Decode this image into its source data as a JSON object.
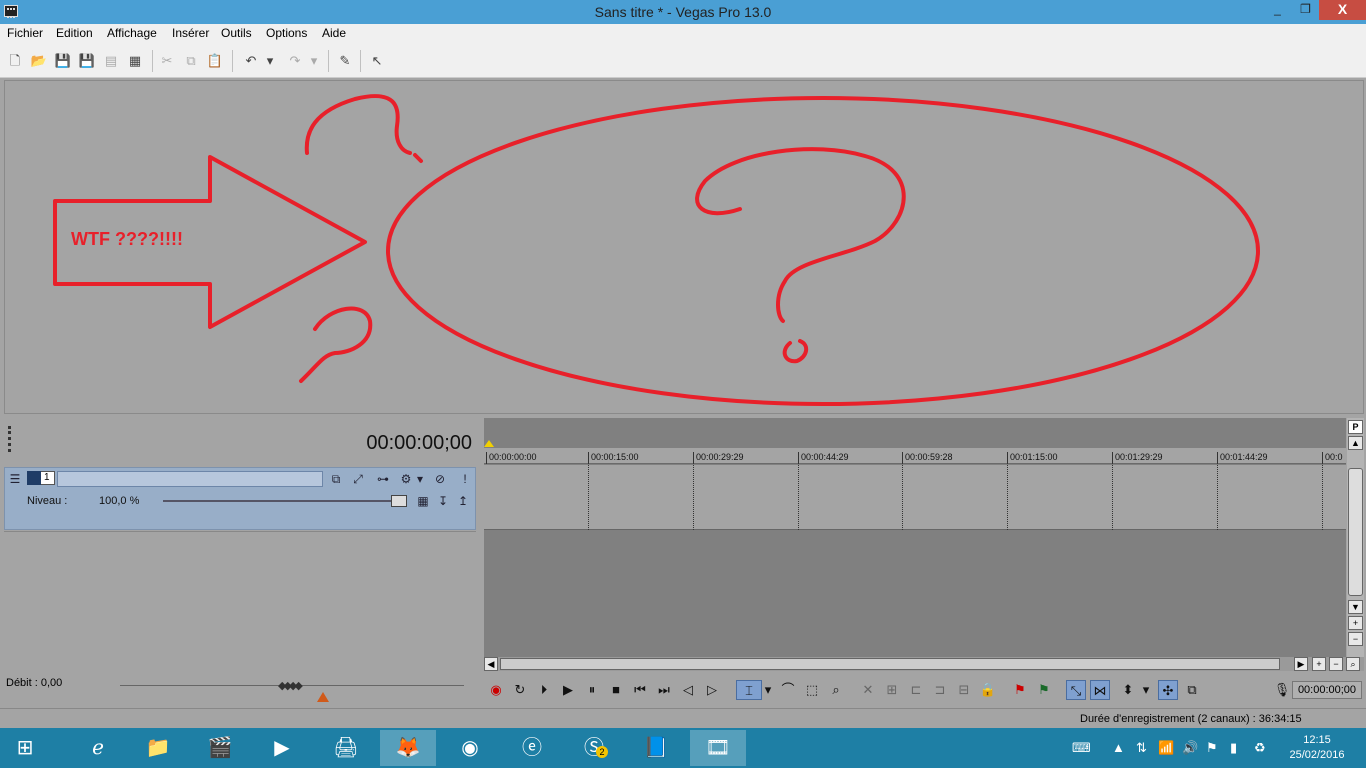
{
  "window": {
    "title": "Sans titre * - Vegas Pro 13.0",
    "minimize": "_",
    "maximize": "❐",
    "close": "X"
  },
  "menu": [
    "Fichier",
    "Edition",
    "Affichage",
    "Insérer",
    "Outils",
    "Options",
    "Aide"
  ],
  "preview": {
    "annotation_text": "WTF ????!!!!",
    "annotation_color": "#e8202a"
  },
  "timeline": {
    "timecode": "00:00:00;00",
    "ruler_ticks": [
      "00:00:00:00",
      "00:00:15:00",
      "00:00:29:29",
      "00:00:44:29",
      "00:00:59:28",
      "00:01:15:00",
      "00:01:29:29",
      "00:01:44:29",
      "00:0"
    ],
    "transport_time": "00:00:00;00"
  },
  "track": {
    "number": "1",
    "level_label": "Niveau :",
    "level_value": "100,0 %"
  },
  "bottom": {
    "debit": "Débit : 0,00",
    "status": "Durée d'enregistrement (2 canaux) : 36:34:15"
  },
  "taskbar": {
    "time": "12:15",
    "date": "25/02/2016",
    "skype_badge": "2"
  },
  "colors": {
    "titlebar": "#4a9fd4",
    "track_header": "#98aec8",
    "taskbar": "#1e7fa5",
    "close_button": "#c74d42"
  }
}
